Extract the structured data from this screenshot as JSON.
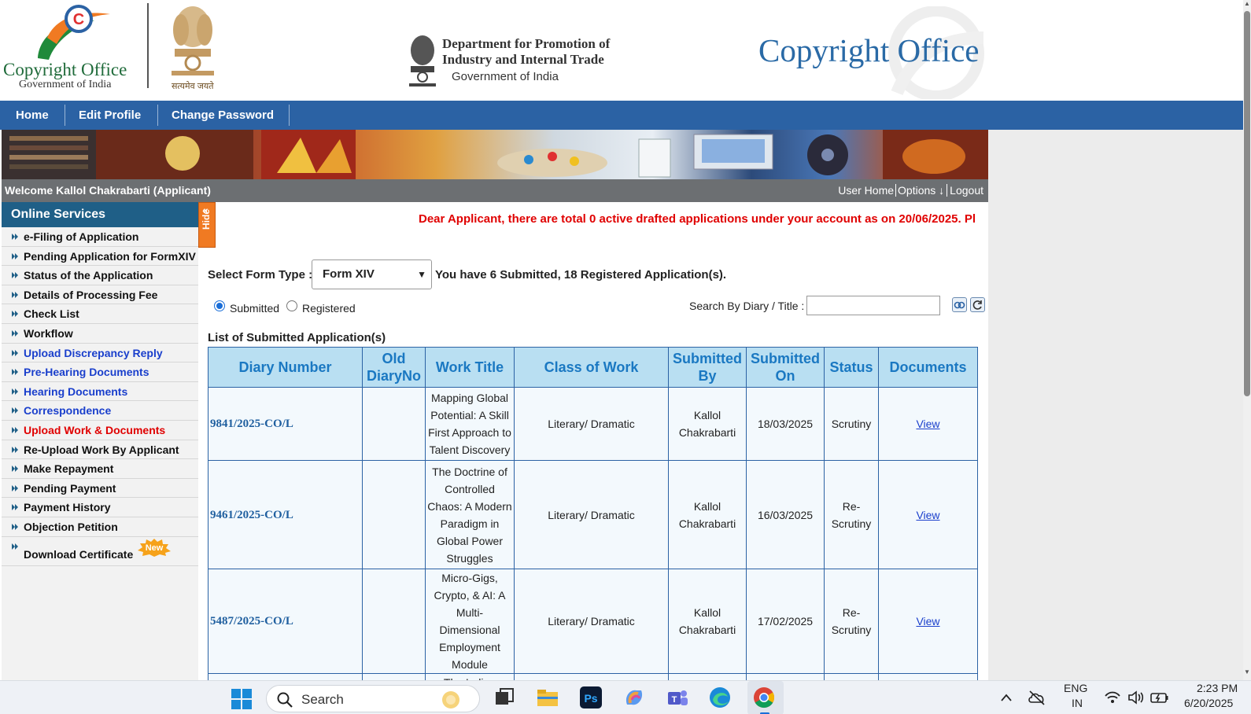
{
  "header": {
    "logo_line1": "Copyright Office",
    "logo_line2": "Government of India",
    "emblem_caption": "सत्यमेव जयते",
    "dept_line1": "Department for Promotion of",
    "dept_line2": "Industry and Internal Trade",
    "dept_line3": "Government of India",
    "title": "Copyright Office"
  },
  "nav": {
    "items": [
      "Home",
      "Edit Profile",
      "Change Password"
    ]
  },
  "welcome": {
    "text": "Welcome Kallol Chakrabarti (Applicant)",
    "user_home": "User Home",
    "options": "Options ↓",
    "logout": "Logout"
  },
  "sidebar": {
    "heading": "Online Services",
    "hide_label": "Hide",
    "new_badge": "New",
    "items": [
      "e-Filing of Application",
      "Pending Application for FormXIV",
      "Status of the Application",
      "Details of Processing Fee",
      "Check List",
      "Workflow",
      "Upload Discrepancy Reply",
      "Pre-Hearing Documents",
      "Hearing Documents",
      "Correspondence",
      "Upload Work & Documents",
      "Re-Upload Work By Applicant",
      "Make Repayment",
      "Pending Payment",
      "Payment History",
      "Objection Petition",
      "Download Certificate"
    ]
  },
  "main": {
    "notice": "Dear Applicant, there are total 0 active drafted applications under your account as on 20/06/2025. Pl",
    "select_label": "Select Form Type :",
    "select_value": "Form XIV",
    "count_text": "You have 6 Submitted, 18 Registered Application(s).",
    "radio_submitted": "Submitted",
    "radio_registered": "Registered",
    "search_label": "Search By Diary / Title :",
    "search_value": "",
    "list_title": "List of Submitted Application(s)",
    "columns": [
      "Diary Number",
      "Old DiaryNo",
      "Work Title",
      "Class of Work",
      "Submitted By",
      "Submitted On",
      "Status",
      "Documents"
    ],
    "rows": [
      {
        "diary": "9841/2025-CO/L",
        "old": "",
        "title": "Mapping Global Potential: A Skill First Approach to Talent Discovery",
        "class": "Literary/ Dramatic",
        "by": "Kallol Chakrabarti",
        "on": "18/03/2025",
        "status": "Scrutiny",
        "doc": "View"
      },
      {
        "diary": "9461/2025-CO/L",
        "old": "",
        "title": "The Doctrine of Controlled Chaos: A Modern Paradigm in Global Power Struggles",
        "class": "Literary/ Dramatic",
        "by": "Kallol Chakrabarti",
        "on": "16/03/2025",
        "status": "Re-Scrutiny",
        "doc": "View"
      },
      {
        "diary": "5487/2025-CO/L",
        "old": "",
        "title": "Micro-Gigs, Crypto, & AI: A Multi-Dimensional Employment Module",
        "class": "Literary/ Dramatic",
        "by": "Kallol Chakrabarti",
        "on": "17/02/2025",
        "status": "Re-Scrutiny",
        "doc": "View"
      },
      {
        "diary": "",
        "old": "",
        "title": "The Indian",
        "class": "",
        "by": "",
        "on": "",
        "status": "",
        "doc": ""
      }
    ]
  },
  "taskbar": {
    "search_label": "Search",
    "lang_line1": "ENG",
    "lang_line2": "IN",
    "time": "2:23 PM",
    "date": "6/20/2025"
  },
  "colors": {
    "nav_bg": "#2b62a4",
    "sidebar_head": "#1f5f87",
    "notice": "#e00000",
    "table_header": "#b9dff2",
    "hide_tab": "#f07a22"
  }
}
